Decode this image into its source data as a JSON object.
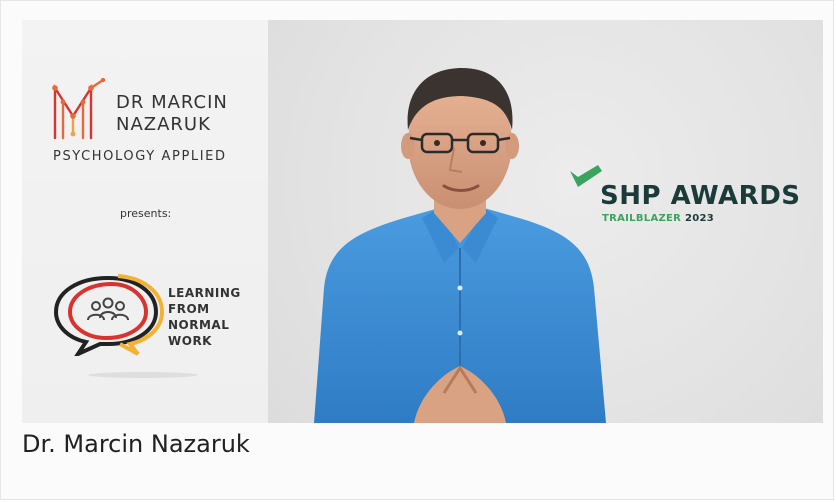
{
  "video": {
    "brand": {
      "name_line1": "DR MARCIN",
      "name_line2": "NAZARUK",
      "tagline": "PSYCHOLOGY APPLIED",
      "presents": "presents:"
    },
    "program_logo": {
      "line1": "LEARNING",
      "line2": "FROM",
      "line3": "NORMAL",
      "line4": "WORK"
    },
    "award": {
      "title": "SHP AWARDS",
      "subtitle_a": "TRAILBLAZER",
      "subtitle_b": " 2023"
    },
    "colors": {
      "brand_orange": "#e86a3b",
      "brand_red": "#d9332f",
      "award_green": "#3aa35e",
      "award_dark": "#1b3a3a",
      "shirt_blue": "#3c8dd6"
    }
  },
  "caption": {
    "text": "Dr. Marcin Nazaruk"
  },
  "icons": [
    "brand-monogram-icon",
    "speech-bubbles-icon",
    "people-icon",
    "award-check-icon"
  ]
}
